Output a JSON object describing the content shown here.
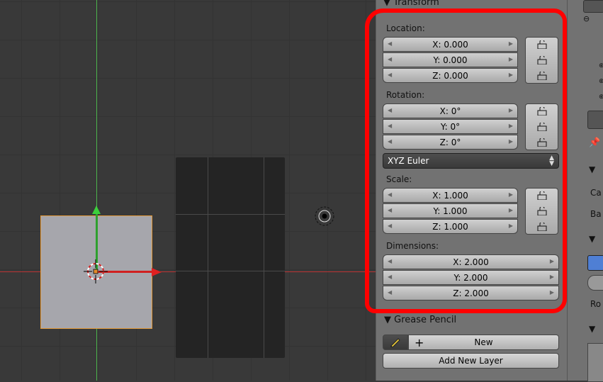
{
  "transform_panel": {
    "title": "Transform",
    "location": {
      "label": "Location:",
      "x": "X: 0.000",
      "y": "Y: 0.000",
      "z": "Z: 0.000"
    },
    "rotation": {
      "label": "Rotation:",
      "x": "X: 0°",
      "y": "Y: 0°",
      "z": "Z: 0°"
    },
    "rotation_mode": "XYZ Euler",
    "scale": {
      "label": "Scale:",
      "x": "X: 1.000",
      "y": "Y: 1.000",
      "z": "Z: 1.000"
    },
    "dimensions": {
      "label": "Dimensions:",
      "x": "X: 2.000",
      "y": "Y: 2.000",
      "z": "Z: 2.000"
    }
  },
  "grease_pencil": {
    "title": "Grease Pencil",
    "new_label": "New",
    "add_layer_label": "Add New Layer"
  },
  "right_strip": {
    "item1": "Ca",
    "item2": "Ba",
    "item3": "Ro"
  },
  "colors": {
    "highlight": "#ff0000",
    "selected_outline": "#e39a3a",
    "x_axis": "#d02020",
    "y_axis": "#3ccf3c"
  }
}
